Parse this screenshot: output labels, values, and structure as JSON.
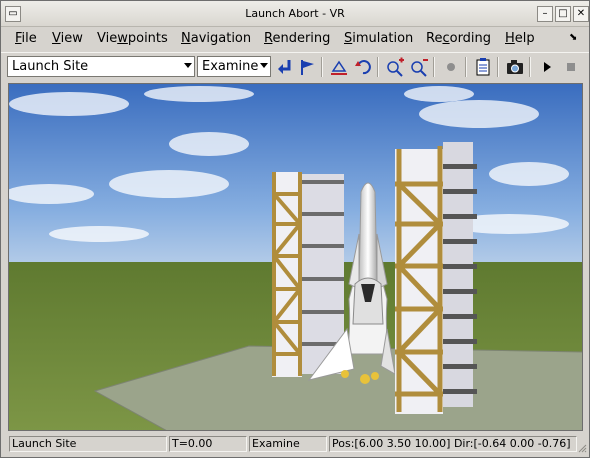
{
  "window": {
    "title": "Launch Abort - VR"
  },
  "menu": [
    {
      "underline": "F",
      "rest": "ile"
    },
    {
      "underline": "V",
      "rest": "iew"
    },
    {
      "pre": "Vie",
      "underline": "w",
      "rest": "points"
    },
    {
      "underline": "N",
      "rest": "avigation"
    },
    {
      "underline": "R",
      "rest": "endering"
    },
    {
      "underline": "S",
      "rest": "imulation"
    },
    {
      "pre": "Re",
      "underline": "c",
      "rest": "ording"
    },
    {
      "underline": "H",
      "rest": "elp"
    }
  ],
  "toolbar": {
    "viewpoint_selected": "Launch Site",
    "navigation_mode": "Examine"
  },
  "status": {
    "viewpoint": "Launch Site",
    "time": "T=0.00",
    "mode": "Examine",
    "position": "Pos:[6.00 3.50 10.00] Dir:[-0.64 0.00 -0.76]"
  },
  "colors": {
    "sky_top": "#3c6fc0",
    "sky_horizon": "#a9c4e6",
    "ground": "#6f8a3c",
    "pad": "#9aa38a",
    "tower_wood": "#b08d3c",
    "tower_face": "#e6e6ea",
    "shuttle": "#ececec"
  }
}
